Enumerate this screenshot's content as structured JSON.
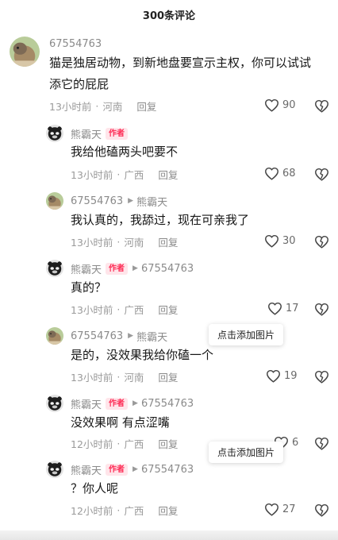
{
  "header": {
    "title": "300条评论"
  },
  "tooltip_label": "点击添加图片",
  "author_badge": "作者",
  "reply_label": "回复",
  "comments": [
    {
      "name": "67554763",
      "text": "猫是独居动物，到新地盘要宣示主权，你可以试试\n添它的屁屁",
      "time": "13小时前",
      "location": "河南",
      "likes": "90"
    },
    {
      "name": "熊霸天",
      "is_author": true,
      "text": "我给他磕两头吧要不",
      "time": "13小时前",
      "location": "广西",
      "likes": "68"
    },
    {
      "name": "67554763",
      "reply_to": "熊霸天",
      "text": "我认真的，我舔过，现在可亲我了",
      "time": "13小时前",
      "location": "河南",
      "likes": "30"
    },
    {
      "name": "熊霸天",
      "is_author": true,
      "reply_to": "67554763",
      "text": "真的？",
      "time": "13小时前",
      "location": "广西",
      "likes": "17"
    },
    {
      "name": "67554763",
      "reply_to": "熊霸天",
      "text": "是的，没效果我给你磕一个",
      "time": "13小时前",
      "location": "河南",
      "likes": "19"
    },
    {
      "name": "熊霸天",
      "is_author": true,
      "reply_to": "67554763",
      "text": "没效果啊 有点涩嘴",
      "time": "12小时前",
      "location": "广西",
      "likes": "6"
    },
    {
      "name": "熊霸天",
      "is_author": true,
      "reply_to": "67554763",
      "text": "？你人呢",
      "time": "12小时前",
      "location": "广西",
      "likes": "27"
    }
  ],
  "icons": {
    "like": "heart-outline-icon",
    "dislike": "broken-heart-icon",
    "reply_arrow": "triangle-right-icon"
  },
  "colors": {
    "author_badge_text": "#fe2c55",
    "author_badge_bg": "#ffe5ea",
    "meta_gray": "#9a9a9a"
  }
}
